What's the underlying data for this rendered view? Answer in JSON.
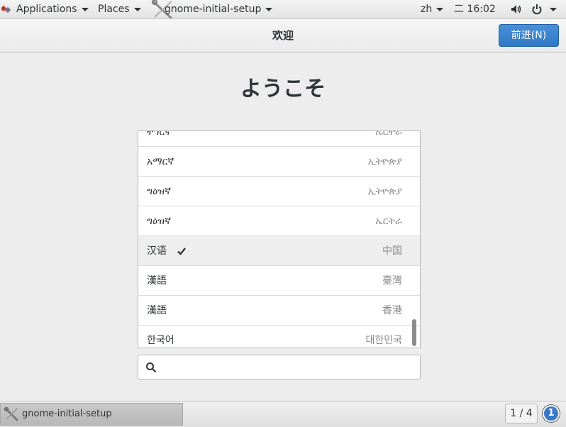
{
  "topbar": {
    "applications_label": "Applications",
    "places_label": "Places",
    "app_menu_label": "gnome-initial-setup",
    "input_method": "zh",
    "clock": "二 16:02"
  },
  "header": {
    "title": "欢迎",
    "next_button_label": "前进(N)"
  },
  "welcome_text": "ようこそ",
  "languages": [
    {
      "name": "ትግርኛ",
      "region": "ኤርትራ",
      "selected": false
    },
    {
      "name": "አማርኛ",
      "region": "ኢትዮጵያ",
      "selected": false
    },
    {
      "name": "ግዕዝኛ",
      "region": "ኢትዮጵያ",
      "selected": false
    },
    {
      "name": "ግዕዝኛ",
      "region": "ኤርትራ",
      "selected": false
    },
    {
      "name": "汉语",
      "region": "中国",
      "selected": true
    },
    {
      "name": "漢語",
      "region": "臺灣",
      "selected": false
    },
    {
      "name": "漢語",
      "region": "香港",
      "selected": false
    },
    {
      "name": "한국어",
      "region": "대한민국",
      "selected": false
    }
  ],
  "search": {
    "placeholder": ""
  },
  "taskbar": {
    "window_label": "gnome-initial-setup",
    "workspace": "1 / 4",
    "notification_count": "1"
  },
  "colors": {
    "accent": "#3584e4",
    "selected_row": "#eeeeee"
  }
}
